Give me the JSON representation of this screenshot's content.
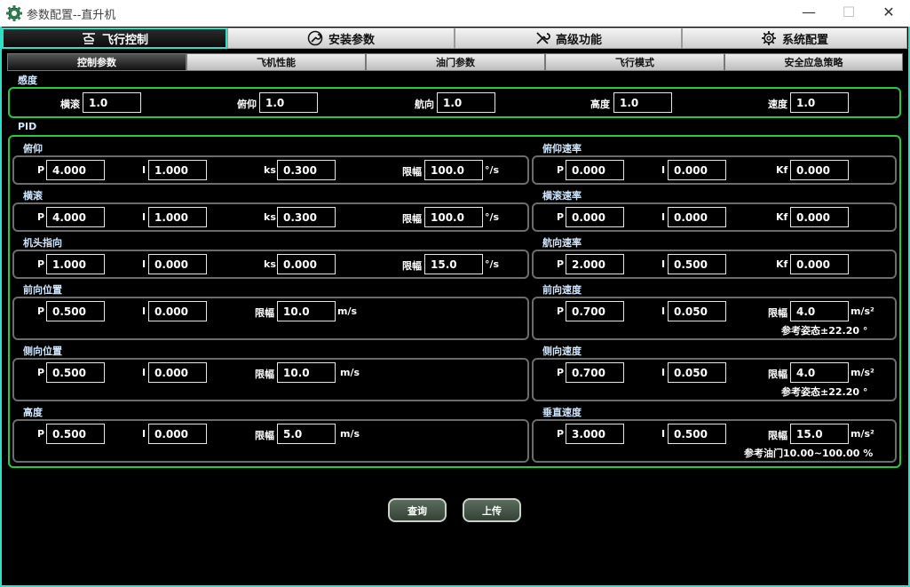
{
  "window": {
    "title": "参数配置--直升机",
    "minimize": "—",
    "maximize": "☐",
    "close": "✕"
  },
  "main_tabs": [
    "飞行控制",
    "安装参数",
    "高级功能",
    "系统配置"
  ],
  "sub_tabs": [
    "控制参数",
    "飞机性能",
    "油门参数",
    "飞行模式",
    "安全应急策略"
  ],
  "sensitivity": {
    "section": "感度",
    "items": [
      {
        "label": "横滚",
        "value": "1.0"
      },
      {
        "label": "俯仰",
        "value": "1.0"
      },
      {
        "label": "航向",
        "value": "1.0"
      },
      {
        "label": "高度",
        "value": "1.0"
      },
      {
        "label": "速度",
        "value": "1.0"
      }
    ]
  },
  "pid": {
    "section": "PID",
    "pitch": {
      "title": "俯仰",
      "P": "4.000",
      "I": "1.000",
      "ks": "0.300",
      "limit": "100.0",
      "unit": "°/s"
    },
    "roll": {
      "title": "横滚",
      "P": "4.000",
      "I": "1.000",
      "ks": "0.300",
      "limit": "100.0",
      "unit": "°/s"
    },
    "heading": {
      "title": "机头指向",
      "P": "1.000",
      "I": "0.000",
      "ks": "0.000",
      "limit": "15.0",
      "unit": "°/s"
    },
    "fwd_pos": {
      "title": "前向位置",
      "P": "0.500",
      "I": "0.000",
      "limit": "10.0",
      "unit": "m/s"
    },
    "side_pos": {
      "title": "侧向位置",
      "P": "0.500",
      "I": "0.000",
      "limit": "10.0",
      "unit": "m/s"
    },
    "altitude": {
      "title": "高度",
      "P": "0.500",
      "I": "0.000",
      "limit": "5.0",
      "unit": "m/s"
    },
    "pitch_rate": {
      "title": "俯仰速率",
      "P": "0.000",
      "I": "0.000",
      "Kf": "0.000"
    },
    "roll_rate": {
      "title": "横滚速率",
      "P": "0.000",
      "I": "0.000",
      "Kf": "0.000"
    },
    "yaw_rate": {
      "title": "航向速率",
      "P": "2.000",
      "I": "0.500",
      "Kf": "0.000"
    },
    "fwd_speed": {
      "title": "前向速度",
      "P": "0.700",
      "I": "0.050",
      "limit": "4.0",
      "unit": "m/s²",
      "note": "参考姿态±22.20 °"
    },
    "side_speed": {
      "title": "侧向速度",
      "P": "0.700",
      "I": "0.050",
      "limit": "4.0",
      "unit": "m/s²",
      "note": "参考姿态±22.20 °"
    },
    "vert_speed": {
      "title": "垂直速度",
      "P": "3.000",
      "I": "0.500",
      "limit": "15.0",
      "unit": "m/s²",
      "note": "参考油门10.00~100.00 %"
    }
  },
  "labels": {
    "P": "P",
    "I": "I",
    "ks": "ks",
    "Kf": "Kf",
    "limit": "限幅"
  },
  "buttons": {
    "query": "查询",
    "upload": "上传"
  }
}
